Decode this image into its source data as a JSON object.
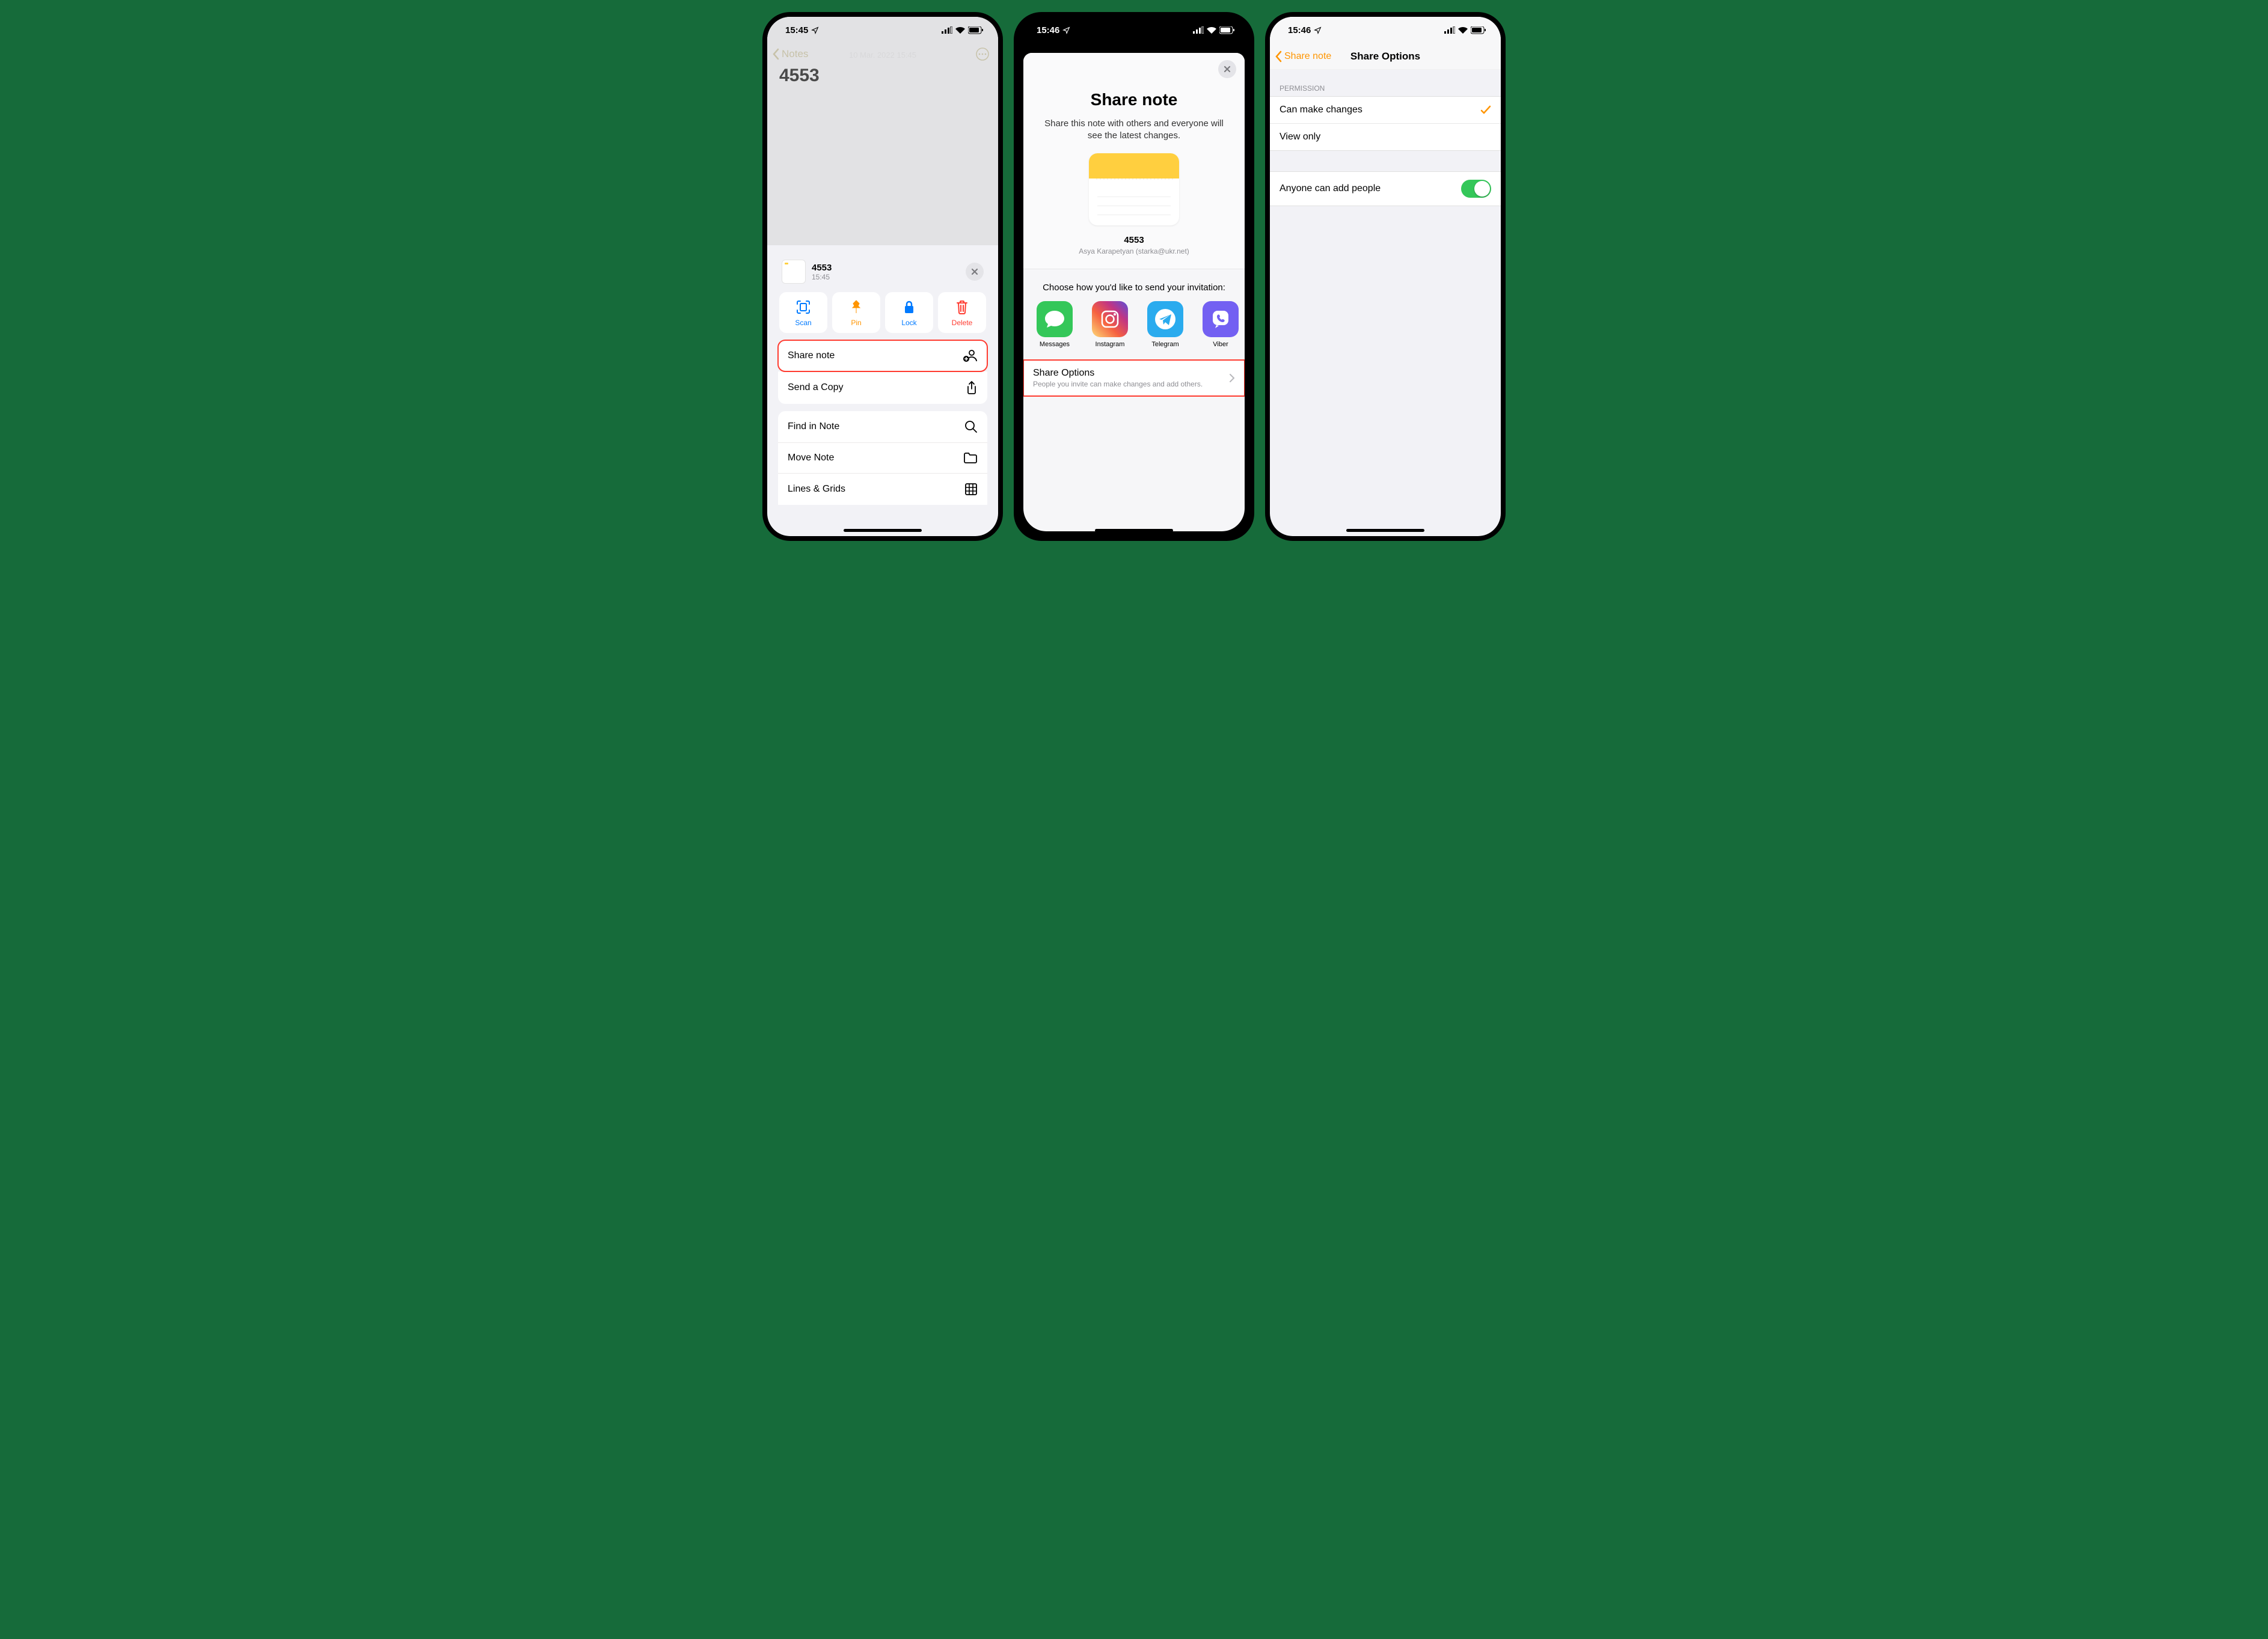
{
  "screen1": {
    "status_time": "15:45",
    "back_label": "Notes",
    "note_title": "4553",
    "dim_date": "10 Mar. 2022  15:45",
    "sheet": {
      "title": "4553",
      "subtitle": "15:45",
      "quick": {
        "scan": "Scan",
        "pin": "Pin",
        "lock": "Lock",
        "delete": "Delete"
      },
      "rows": {
        "share_note": "Share note",
        "send_copy": "Send a Copy",
        "find": "Find in Note",
        "move": "Move Note",
        "lines": "Lines & Grids"
      }
    }
  },
  "screen2": {
    "status_time": "15:46",
    "heading": "Share note",
    "description": "Share this note with others and everyone will see the latest changes.",
    "note_title": "4553",
    "note_owner": "Asya Karapetyan (starka@ukr.net)",
    "choose_text": "Choose how you'd like to send your invitation:",
    "apps": {
      "messages": "Messages",
      "instagram": "Instagram",
      "telegram": "Telegram",
      "viber": "Viber"
    },
    "options_title": "Share Options",
    "options_sub": "People you invite can make changes and add others."
  },
  "screen3": {
    "status_time": "15:46",
    "back_label": "Share note",
    "title": "Share Options",
    "section_permission": "Permission",
    "can_make_changes": "Can make changes",
    "view_only": "View only",
    "anyone_add": "Anyone can add people"
  }
}
